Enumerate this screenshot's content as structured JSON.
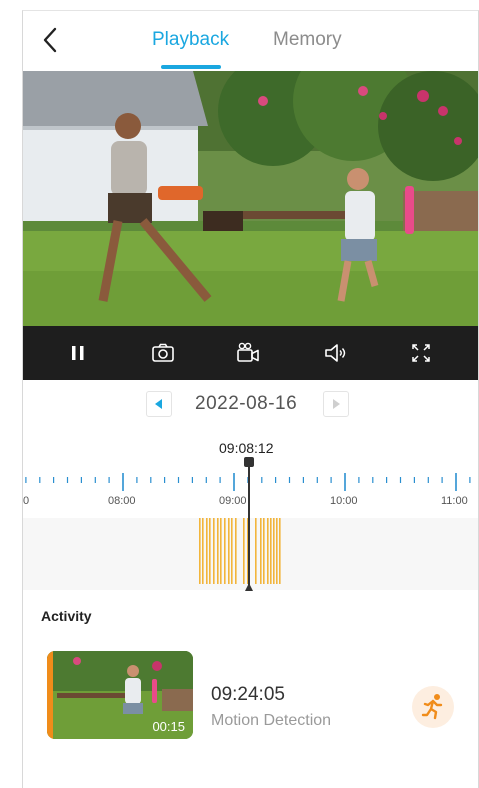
{
  "header": {
    "tabs": [
      {
        "label": "Playback",
        "active": true
      },
      {
        "label": "Memory",
        "active": false
      }
    ],
    "accent_color": "#1aa7e0"
  },
  "player": {
    "controls": [
      "pause-icon",
      "snapshot-camera-icon",
      "record-video-icon",
      "volume-icon",
      "fullscreen-icon"
    ]
  },
  "date_nav": {
    "date": "2022-08-16"
  },
  "timeline": {
    "current_time": "09:08:12",
    "hour_labels": [
      "0",
      "08:00",
      "09:00",
      "10:00",
      "11:00"
    ],
    "event_color": "#f2b53b"
  },
  "activity": {
    "title": "Activity",
    "items": [
      {
        "time": "09:24:05",
        "label": "Motion Detection",
        "duration": "00:15",
        "icon": "running-person-icon"
      }
    ]
  }
}
